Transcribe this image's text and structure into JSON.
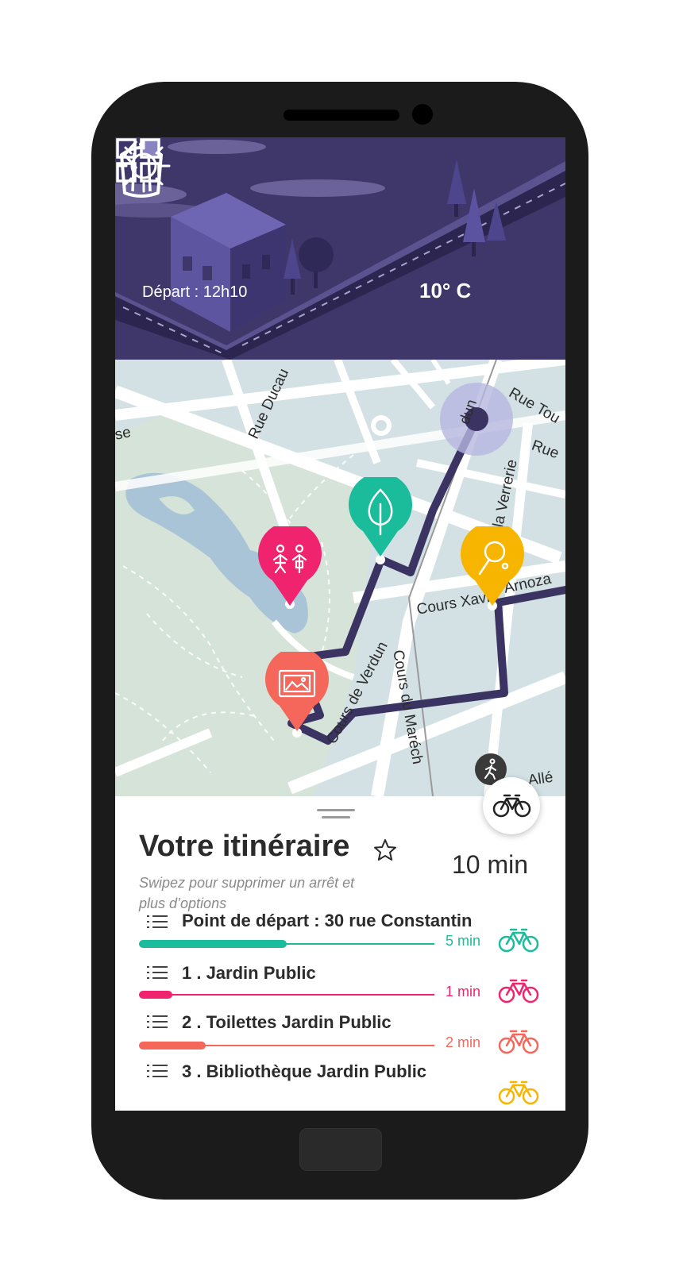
{
  "header": {
    "departure": "Départ : 12h10",
    "temperature": "10° C",
    "weather_icon": "sun-icon",
    "background_color": "#3f3769"
  },
  "map": {
    "streets": [
      "Rue Ducau",
      "Rue Tou",
      "Rue",
      "la Verrerie",
      "Cours Xavi",
      "Arnoza",
      "Cours de Verdun",
      "Cours du Maréch",
      "Allé",
      "se",
      "dun"
    ],
    "pins": [
      {
        "name": "jardin",
        "color": "#1abc9c",
        "icon": "tree-icon"
      },
      {
        "name": "toilettes",
        "color": "#f0246e",
        "icon": "toilets-icon"
      },
      {
        "name": "bibliotheque",
        "color": "#f4675a",
        "icon": "painting-icon"
      },
      {
        "name": "ping-pong",
        "color": "#f7b500",
        "icon": "ping-pong-icon"
      }
    ],
    "route_color": "#3b3361"
  },
  "sheet": {
    "title": "Votre itinéraire",
    "hint": "Swipez pour supprimer un arrêt et plus d’options",
    "total_time": "10 min",
    "steps": [
      {
        "label": "Point de départ : 30 rue Constantin",
        "duration": "5 min",
        "color": "#1abc9c",
        "progress": 0.5
      },
      {
        "label": "1 .  Jardin Public",
        "duration": "1 min",
        "color": "#f0246e",
        "progress": 0.12
      },
      {
        "label": "2 .  Toilettes Jardin Public",
        "duration": "2 min",
        "color": "#f4675a",
        "progress": 0.23
      },
      {
        "label": "3 .  Bibliothèque Jardin Public",
        "duration": "",
        "color": "#f7b500",
        "progress": 0
      }
    ]
  }
}
